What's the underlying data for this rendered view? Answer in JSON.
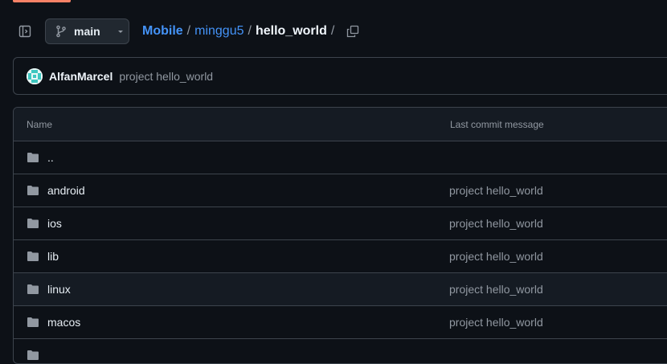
{
  "header": {
    "branch": "main",
    "breadcrumb": {
      "root": "Mobile",
      "segment": "minggu5",
      "current": "hello_world",
      "sep": "/"
    }
  },
  "commit": {
    "author": "AlfanMarcel",
    "message": "project hello_world"
  },
  "table": {
    "columns": {
      "name": "Name",
      "message": "Last commit message"
    },
    "rows": [
      {
        "name": "..",
        "message": ""
      },
      {
        "name": "android",
        "message": "project hello_world"
      },
      {
        "name": "ios",
        "message": "project hello_world"
      },
      {
        "name": "lib",
        "message": "project hello_world"
      },
      {
        "name": "linux",
        "message": "project hello_world"
      },
      {
        "name": "macos",
        "message": "project hello_world"
      }
    ]
  },
  "colors": {
    "accent_link": "#4493f8",
    "background": "#0d1117",
    "border": "#3d444d",
    "muted": "#9198a1"
  },
  "icons": [
    "sidebar-expand-icon",
    "git-branch-icon",
    "chevron-down-icon",
    "copy-icon",
    "folder-icon"
  ]
}
